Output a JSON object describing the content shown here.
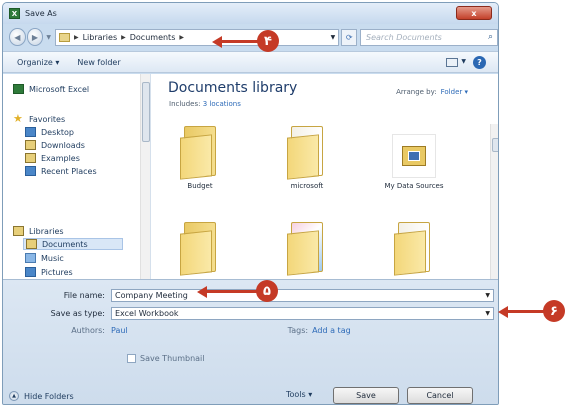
{
  "window": {
    "title": "Save As",
    "close_glyph": "x"
  },
  "nav": {
    "breadcrumb": [
      "Libraries",
      "Documents"
    ],
    "search_placeholder": "Search Documents"
  },
  "toolbar": {
    "organize": "Organize ▾",
    "new_folder": "New folder"
  },
  "sidebar": {
    "items": [
      {
        "label": "Microsoft Excel",
        "icon": "excel-icon"
      },
      {
        "label": "Favorites",
        "icon": "star-icon"
      },
      {
        "label": "Desktop",
        "icon": "desktop-icon"
      },
      {
        "label": "Downloads",
        "icon": "downloads-icon"
      },
      {
        "label": "Examples",
        "icon": "folder-icon"
      },
      {
        "label": "Recent Places",
        "icon": "recent-places-icon"
      },
      {
        "label": "Libraries",
        "icon": "libraries-icon"
      },
      {
        "label": "Documents",
        "icon": "documents-icon"
      },
      {
        "label": "Music",
        "icon": "music-icon"
      },
      {
        "label": "Pictures",
        "icon": "pictures-icon"
      }
    ]
  },
  "main": {
    "title": "Documents library",
    "includes_prefix": "Includes:",
    "includes_link": "3 locations",
    "arrange_label": "Arrange by:",
    "arrange_value": "Folder ▾",
    "tiles": [
      {
        "label": "Budget"
      },
      {
        "label": "microsoft"
      },
      {
        "label": "My Data Sources"
      }
    ]
  },
  "form": {
    "file_name_label": "File name:",
    "file_name_value": "Company Meeting",
    "save_as_type_label": "Save as type:",
    "save_as_type_value": "Excel Workbook",
    "authors_label": "Authors:",
    "authors_value": "Paul",
    "tags_label": "Tags:",
    "tags_value": "Add a tag",
    "save_thumbnail_label": "Save Thumbnail"
  },
  "footer": {
    "hide_folders": "Hide Folders",
    "tools": "Tools ▾",
    "save": "Save",
    "cancel": "Cancel"
  },
  "callouts": [
    "۴",
    "۵",
    "۶"
  ],
  "colors": {
    "callout": "#c53a26",
    "link": "#2e6bb8"
  }
}
